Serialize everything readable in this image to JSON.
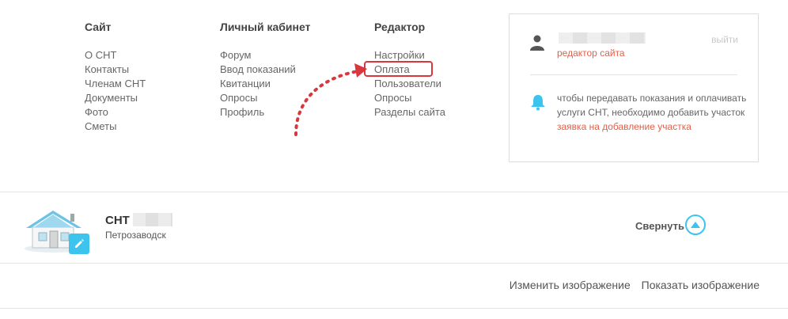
{
  "menu": {
    "site": {
      "title": "Сайт",
      "items": [
        "О СНТ",
        "Контакты",
        "Членам СНТ",
        "Документы",
        "Фото",
        "Сметы"
      ]
    },
    "cabinet": {
      "title": "Личный кабинет",
      "items": [
        "Форум",
        "Ввод показаний",
        "Квитанции",
        "Опросы",
        "Профиль"
      ]
    },
    "editor": {
      "title": "Редактор",
      "items": [
        "Настройки",
        "Оплата",
        "Пользователи",
        "Опросы",
        "Разделы сайта"
      ],
      "highlighted": "Оплата"
    }
  },
  "user_card": {
    "logout": "выйти",
    "role": "редактор сайта",
    "notice": "чтобы передавать показания и оплачивать услуги СНТ, необходимо добавить участок",
    "notice_link": "заявка на добавление участка"
  },
  "org": {
    "title": "СНТ",
    "city": "Петрозаводск"
  },
  "collapse_label": "Свернуть",
  "image_actions": {
    "change": "Изменить изображение",
    "show": "Показать изображение"
  },
  "colors": {
    "accent": "#3cc4ee",
    "link": "#e2604a",
    "highlight": "#d9363e"
  }
}
